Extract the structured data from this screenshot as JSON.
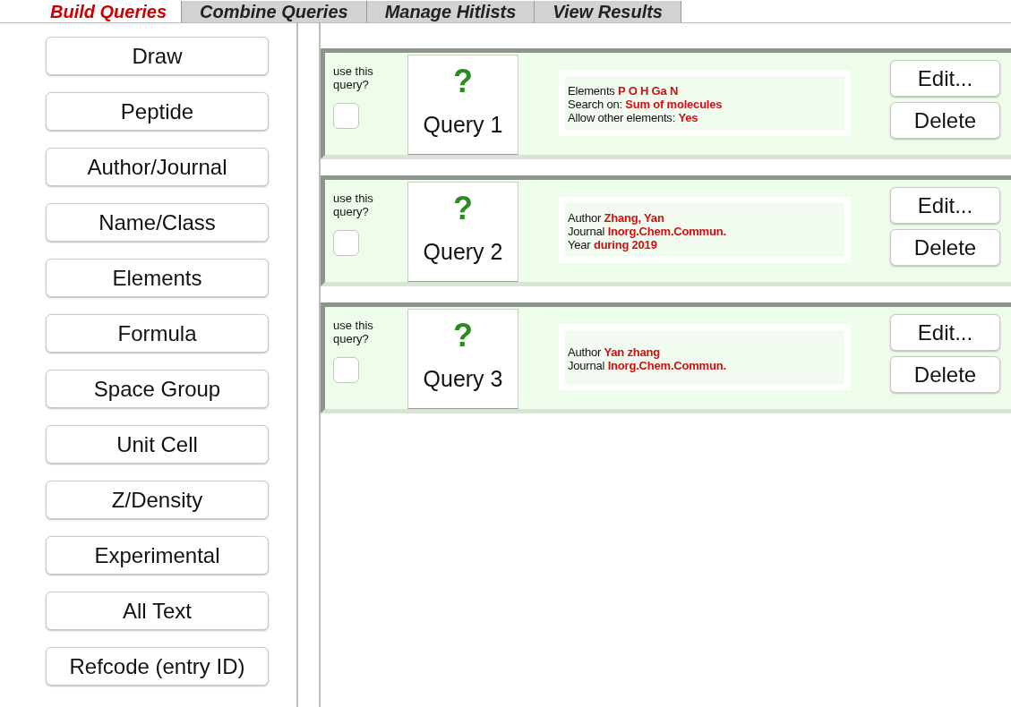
{
  "tabs": [
    {
      "label": "Build Queries",
      "selected": true
    },
    {
      "label": "Combine Queries",
      "selected": false
    },
    {
      "label": "Manage Hitlists",
      "selected": false
    },
    {
      "label": "View Results",
      "selected": false
    }
  ],
  "sidebar": {
    "buttons": [
      "Draw",
      "Peptide",
      "Author/Journal",
      "Name/Class",
      "Elements",
      "Formula",
      "Space Group",
      "Unit Cell",
      "Z/Density",
      "Experimental",
      "All Text",
      "Refcode (entry ID)"
    ]
  },
  "queries": [
    {
      "use_label": "use this query?",
      "checked": false,
      "name": "Query 1",
      "icon": "?",
      "criteria": [
        {
          "label": "Elements",
          "value": "P O H Ga N"
        },
        {
          "label": "Search on:",
          "value": "Sum of molecules"
        },
        {
          "label": "Allow other elements:",
          "value": "Yes"
        }
      ],
      "buttons": [
        "Edit...",
        "Delete"
      ]
    },
    {
      "use_label": "use this query?",
      "checked": false,
      "name": "Query 2",
      "icon": "?",
      "criteria": [
        {
          "label": "Author",
          "value": "Zhang, Yan"
        },
        {
          "label": "Journal",
          "value": "Inorg.Chem.Commun."
        },
        {
          "label": "Year",
          "value": "during 2019"
        }
      ],
      "buttons": [
        "Edit...",
        "Delete"
      ]
    },
    {
      "use_label": "use this query?",
      "checked": false,
      "name": "Query 3",
      "icon": "?",
      "criteria": [
        {
          "label": "Author",
          "value": "Yan zhang"
        },
        {
          "label": "Journal",
          "value": "Inorg.Chem.Commun."
        }
      ],
      "buttons": [
        "Edit...",
        "Delete"
      ]
    }
  ]
}
